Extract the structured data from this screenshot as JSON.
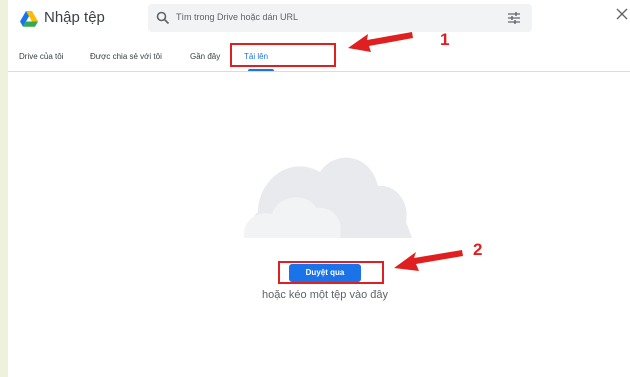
{
  "header": {
    "title": "Nhập tệp",
    "search_placeholder": "Tìm trong Drive hoặc dán URL",
    "icons": [
      "drive-logo-icon",
      "search-icon",
      "filter-icon",
      "close-icon"
    ]
  },
  "tabs": [
    {
      "label": "Drive của tôi",
      "active": false
    },
    {
      "label": "Được chia sẻ với tôi",
      "active": false
    },
    {
      "label": "Gần đây",
      "active": false
    },
    {
      "label": "Tải lên",
      "active": true
    }
  ],
  "upload": {
    "browse_label": "Duyệt qua",
    "drag_text": "hoặc kéo một tệp vào đây"
  },
  "annotations": {
    "marker_1": "1",
    "marker_2": "2"
  },
  "colors": {
    "accent": "#1a73e8",
    "annotation_red": "#e02020",
    "page_background": "#eef2dc"
  }
}
